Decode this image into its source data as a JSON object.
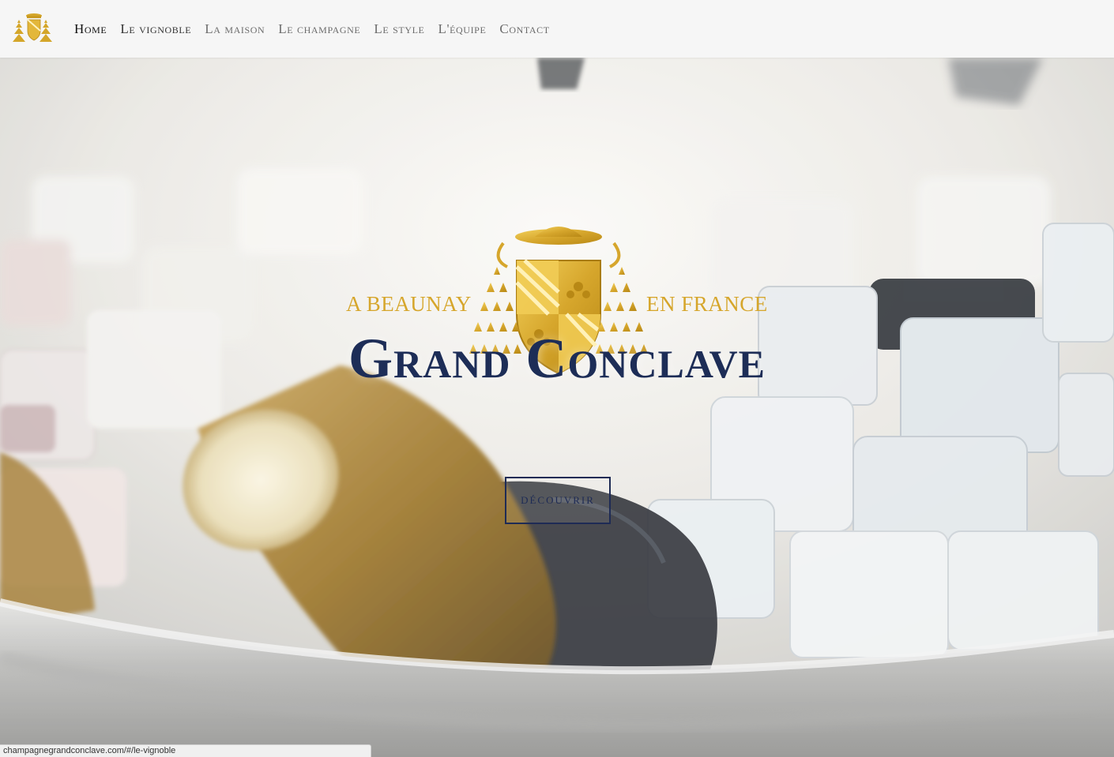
{
  "nav": {
    "items": [
      {
        "label": "Home"
      },
      {
        "label": "Le vignoble"
      },
      {
        "label": "La maison"
      },
      {
        "label": "Le champagne"
      },
      {
        "label": "Le style"
      },
      {
        "label": "L'équipe"
      },
      {
        "label": "Contact"
      }
    ]
  },
  "hero": {
    "crest_left": "A BEAUNAY",
    "crest_right": "EN FRANCE",
    "title": "Grand Conclave",
    "cta_label": "DÉCOUVRIR"
  },
  "status_bar": {
    "url": "champagnegrandconclave.com/#/le-vignoble"
  },
  "colors": {
    "gold": "#d6a62c",
    "navy": "#1e2b55",
    "nav_bg": "#f6f6f6"
  }
}
